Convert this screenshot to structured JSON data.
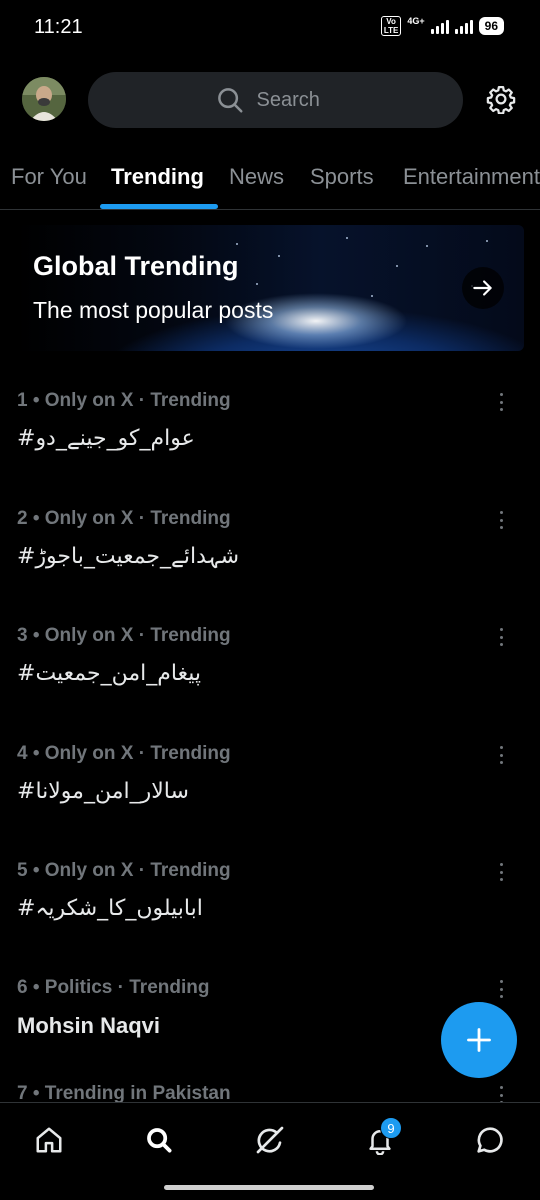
{
  "status_bar": {
    "time": "11:21",
    "volte": "Vo LTE",
    "network": "4G+",
    "battery": "96"
  },
  "header": {
    "avatar": "profile-avatar",
    "search_placeholder": "Search"
  },
  "tabs": [
    {
      "label": "For You",
      "active": false
    },
    {
      "label": "Trending",
      "active": true
    },
    {
      "label": "News",
      "active": false
    },
    {
      "label": "Sports",
      "active": false
    },
    {
      "label": "Entertainment",
      "active": false
    }
  ],
  "banner": {
    "title": "Global Trending",
    "subtitle": "The most popular posts"
  },
  "trends": [
    {
      "meta": "1 • Only on X · Trending",
      "title": "#عوام_کو_جینے_دو"
    },
    {
      "meta": "2 • Only on X · Trending",
      "title": "#شہدائے_جمعیت_باجوڑ"
    },
    {
      "meta": "3 • Only on X · Trending",
      "title": "#پیغام_امن_جمعیت"
    },
    {
      "meta": "4 • Only on X · Trending",
      "title": "#سالار_امن_مولانا"
    },
    {
      "meta": "5 • Only on X · Trending",
      "title": "#ابابیلوں_کا_شکریہ"
    },
    {
      "meta": "6 • Politics · Trending",
      "title": "Mohsin Naqvi"
    },
    {
      "meta": "7 • Trending in Pakistan",
      "title": ""
    }
  ],
  "bottom_nav": {
    "notifications_badge": "9",
    "items": [
      "home-icon",
      "search-icon",
      "grok-icon",
      "notifications-icon",
      "messages-icon"
    ]
  },
  "colors": {
    "accent": "#1d9bf0",
    "background": "#000000",
    "muted_text": "#71767b"
  }
}
